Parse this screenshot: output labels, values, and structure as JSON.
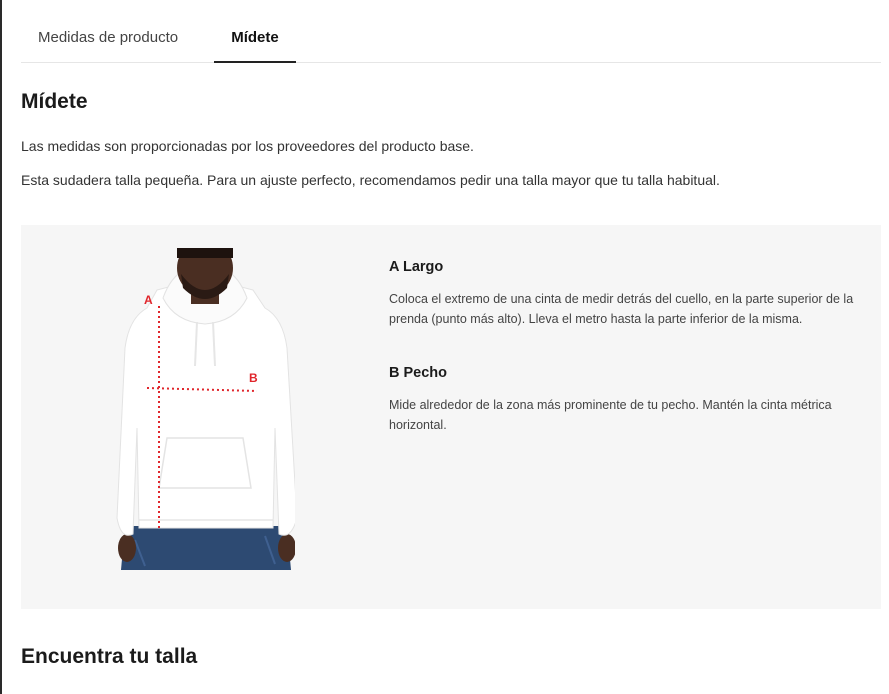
{
  "tabs": [
    {
      "label": "Medidas de producto",
      "active": false
    },
    {
      "label": "Mídete",
      "active": true
    }
  ],
  "section": {
    "title": "Mídete",
    "paragraph_1": "Las medidas son proporcionadas por los proveedores del producto base.",
    "paragraph_2": "Esta sudadera talla pequeña. Para un ajuste perfecto, recomendamos pedir una talla mayor que tu talla habitual."
  },
  "guide": {
    "figure": {
      "marker_a": "A",
      "marker_b": "B",
      "marker_color": "#e0252b"
    },
    "items": [
      {
        "title": "A Largo",
        "text": "Coloca el extremo de una cinta de medir detrás del cuello, en la parte superior de la prenda (punto más alto). Lleva el metro hasta la parte inferior de la misma."
      },
      {
        "title": "B Pecho",
        "text": "Mide alrededor de la zona más prominente de tu pecho. Mantén la cinta métrica horizontal."
      }
    ]
  },
  "find_size": {
    "title": "Encuentra tu talla"
  }
}
